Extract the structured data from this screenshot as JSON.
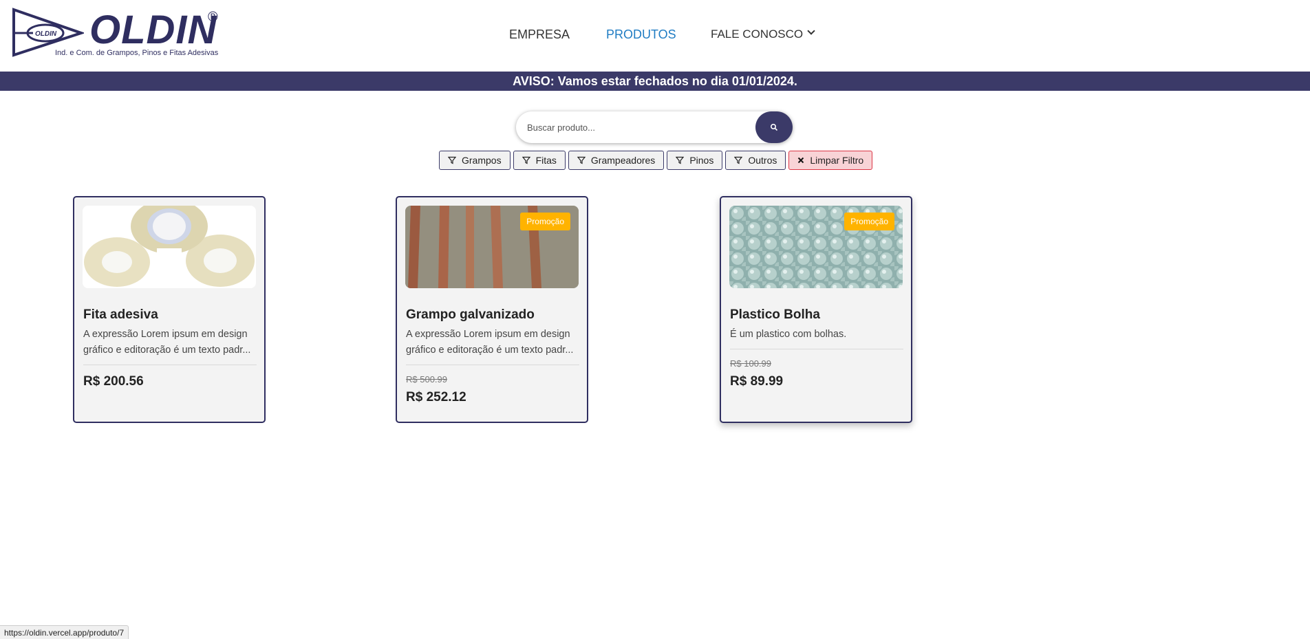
{
  "brand": {
    "name": "OLDIN",
    "registered": "®",
    "tagline": "Ind. e Com. de Grampos, Pinos e Fitas Adesivas",
    "primary_color": "#2f2e60"
  },
  "nav": {
    "items": [
      {
        "label": "EMPRESA",
        "active": false
      },
      {
        "label": "PRODUTOS",
        "active": true
      },
      {
        "label": "FALE CONOSCO",
        "active": false,
        "has_dropdown": true
      }
    ]
  },
  "notice": {
    "text": "AVISO: Vamos estar fechados no dia 01/01/2024."
  },
  "search": {
    "placeholder": "Buscar produto...",
    "value": "",
    "button_icon": "search-icon"
  },
  "filters": [
    {
      "label": "Grampos",
      "icon": "filter-icon"
    },
    {
      "label": "Fitas",
      "icon": "filter-icon"
    },
    {
      "label": "Grampeadores",
      "icon": "filter-icon"
    },
    {
      "label": "Pinos",
      "icon": "filter-icon"
    },
    {
      "label": "Outros",
      "icon": "filter-icon"
    },
    {
      "label": "Limpar Filtro",
      "icon": "close-icon"
    }
  ],
  "products": [
    {
      "title": "Fita adesiva",
      "description": "A expressão Lorem ipsum em design gráfico e editoração é um texto padr...",
      "old_price": "",
      "price": "R$ 200.56",
      "badge": ""
    },
    {
      "title": "Grampo galvanizado",
      "description": "A expressão Lorem ipsum em design gráfico e editoração é um texto padr...",
      "old_price": "R$ 500.99",
      "price": "R$ 252.12",
      "badge": "Promoção"
    },
    {
      "title": "Plastico Bolha",
      "description": "É um plastico com bolhas.",
      "old_price": "R$ 100.99",
      "price": "R$ 89.99",
      "badge": "Promoção"
    }
  ],
  "status_url": "https://oldin.vercel.app/produto/7",
  "colors": {
    "notice_bg": "#3b3a68",
    "active_nav": "#1f7cc3",
    "badge": "#ffb300",
    "clear_filter_bg": "#f8d3d6",
    "clear_filter_border": "#dc3545"
  }
}
